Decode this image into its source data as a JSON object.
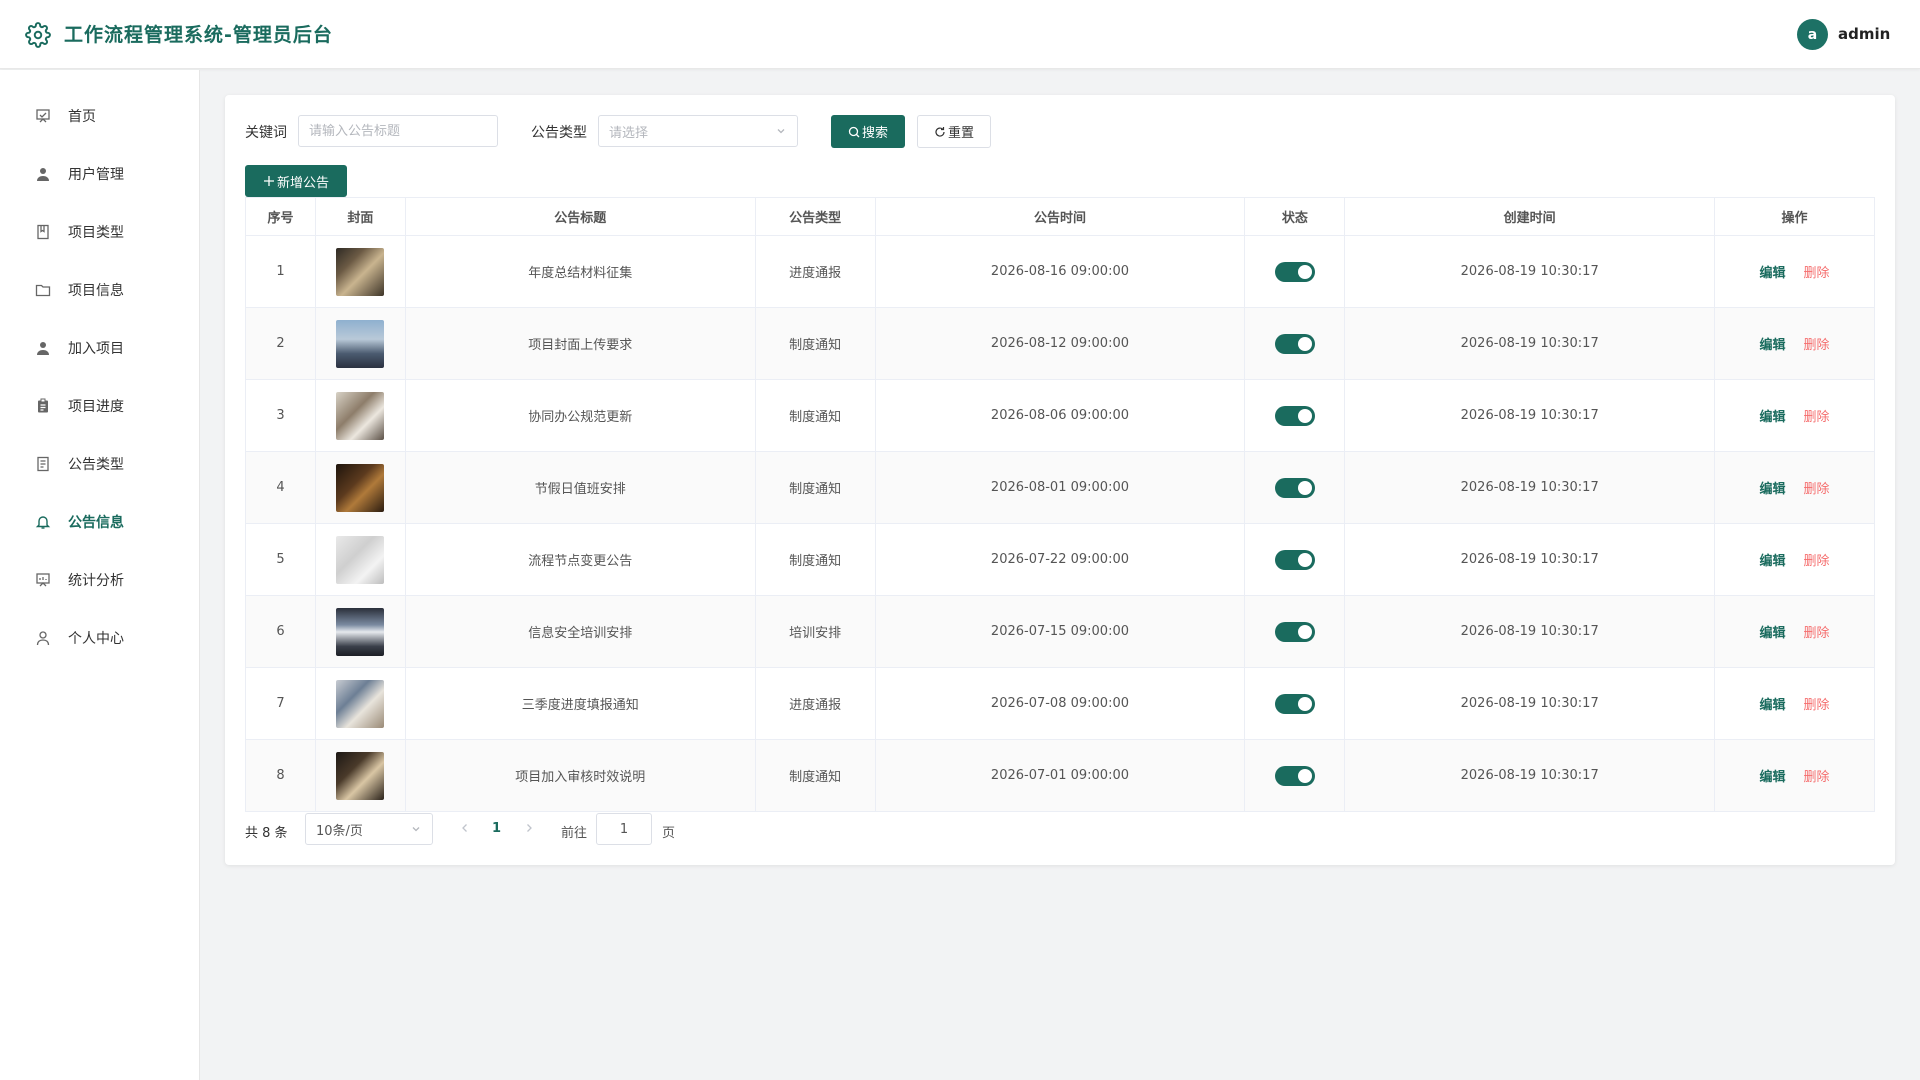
{
  "header": {
    "title": "工作流程管理系统-管理员后台",
    "avatar_letter": "a",
    "username": "admin",
    "accent": "#1a6b5e"
  },
  "sidebar": {
    "items": [
      {
        "label": "首页",
        "icon": "home-icon"
      },
      {
        "label": "用户管理",
        "icon": "user-icon"
      },
      {
        "label": "项目类型",
        "icon": "book-icon"
      },
      {
        "label": "项目信息",
        "icon": "folder-icon"
      },
      {
        "label": "加入项目",
        "icon": "user-add-icon"
      },
      {
        "label": "项目进度",
        "icon": "clipboard-icon"
      },
      {
        "label": "公告类型",
        "icon": "document-icon"
      },
      {
        "label": "公告信息",
        "icon": "bell-icon",
        "active": true
      },
      {
        "label": "统计分析",
        "icon": "chart-icon"
      },
      {
        "label": "个人中心",
        "icon": "profile-icon"
      }
    ]
  },
  "filters": {
    "keyword_label": "关键词",
    "keyword_placeholder": "请输入公告标题",
    "type_label": "公告类型",
    "type_placeholder": "请选择",
    "search_label": "搜索",
    "reset_label": "重置",
    "add_label": "新增公告"
  },
  "table": {
    "columns": [
      "序号",
      "封面",
      "公告标题",
      "公告类型",
      "公告时间",
      "状态",
      "创建时间",
      "操作"
    ],
    "edit_label": "编辑",
    "delete_label": "删除",
    "rows": [
      {
        "index": "1",
        "title": "年度总结材料征集",
        "type": "进度通报",
        "time": "2026-08-16 09:00:00",
        "status": true,
        "created": "2026-08-19 10:30:17"
      },
      {
        "index": "2",
        "title": "项目封面上传要求",
        "type": "制度通知",
        "time": "2026-08-12 09:00:00",
        "status": true,
        "created": "2026-08-19 10:30:17"
      },
      {
        "index": "3",
        "title": "协同办公规范更新",
        "type": "制度通知",
        "time": "2026-08-06 09:00:00",
        "status": true,
        "created": "2026-08-19 10:30:17"
      },
      {
        "index": "4",
        "title": "节假日值班安排",
        "type": "制度通知",
        "time": "2026-08-01 09:00:00",
        "status": true,
        "created": "2026-08-19 10:30:17"
      },
      {
        "index": "5",
        "title": "流程节点变更公告",
        "type": "制度通知",
        "time": "2026-07-22 09:00:00",
        "status": true,
        "created": "2026-08-19 10:30:17"
      },
      {
        "index": "6",
        "title": "信息安全培训安排",
        "type": "培训安排",
        "time": "2026-07-15 09:00:00",
        "status": true,
        "created": "2026-08-19 10:30:17"
      },
      {
        "index": "7",
        "title": "三季度进度填报通知",
        "type": "进度通报",
        "time": "2026-07-08 09:00:00",
        "status": true,
        "created": "2026-08-19 10:30:17"
      },
      {
        "index": "8",
        "title": "项目加入审核时效说明",
        "type": "制度通知",
        "time": "2026-07-01 09:00:00",
        "status": true,
        "created": "2026-08-19 10:30:17"
      }
    ]
  },
  "pagination": {
    "total": "共 8 条",
    "page_size": "10条/页",
    "current_page": "1",
    "goto_label": "前往",
    "goto_value": "1",
    "page_unit": "页"
  }
}
